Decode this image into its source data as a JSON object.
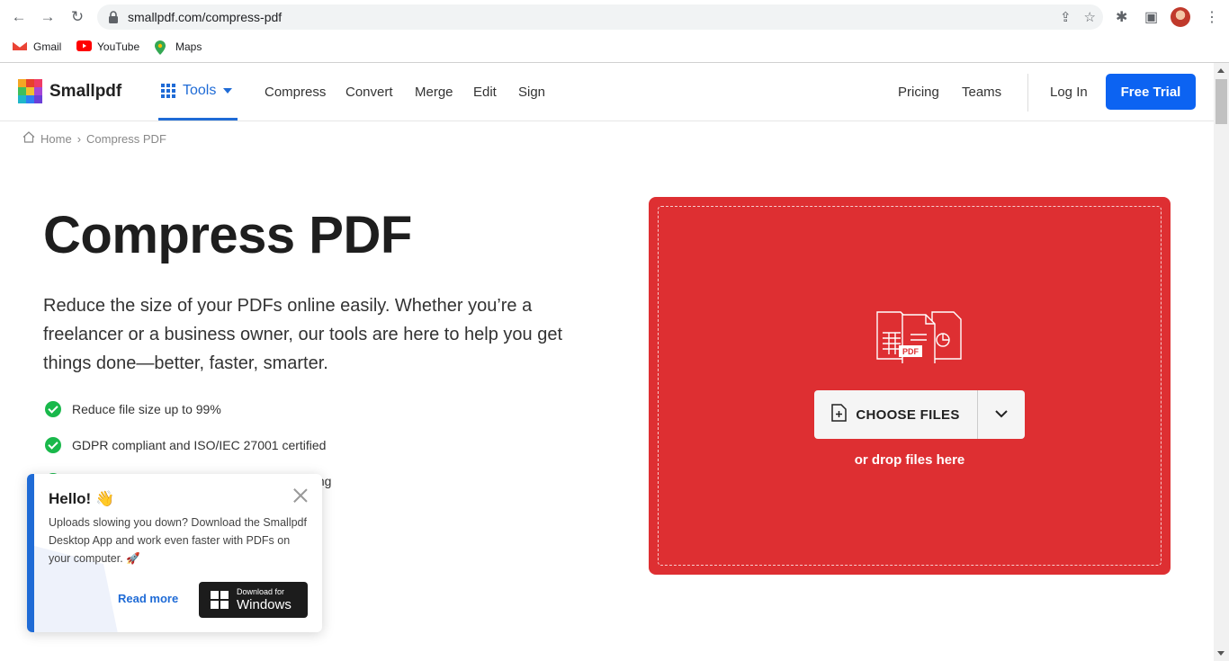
{
  "browser": {
    "url": "smallpdf.com/compress-pdf",
    "bookmarks": [
      "Gmail",
      "YouTube",
      "Maps"
    ]
  },
  "header": {
    "logo": "Smallpdf",
    "tools_label": "Tools",
    "nav": [
      "Compress",
      "Convert",
      "Merge",
      "Edit",
      "Sign"
    ],
    "right_nav": [
      "Pricing",
      "Teams"
    ],
    "login": "Log In",
    "free_trial": "Free Trial",
    "accent_color": "#0c63f2"
  },
  "breadcrumb": {
    "home": "Home",
    "separator": "›",
    "current": "Compress PDF"
  },
  "hero": {
    "title": "Compress PDF",
    "description": "Reduce the size of your PDFs online easily. Whether you’re a freelancer or a business owner, our tools are here to help you get things done—better, faster, smarter.",
    "features": [
      "Reduce file size up to 99%",
      "GDPR compliant and ISO/IEC 27001 certified",
      "essing"
    ]
  },
  "dropzone": {
    "color": "#de2f32",
    "choose_files": "CHOOSE FILES",
    "drop_text": "or drop files here",
    "pdf_badge": "PDF"
  },
  "popup": {
    "title": "Hello! 👋",
    "body": "Uploads slowing you down? Download the Smallpdf Desktop App and work even faster with PDFs on your computer. 🚀",
    "read_more": "Read more",
    "download_small": "Download for",
    "download_big": "Windows"
  }
}
